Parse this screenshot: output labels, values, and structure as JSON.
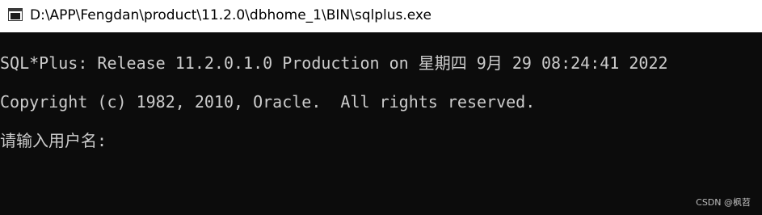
{
  "window": {
    "title": "D:\\APP\\Fengdan\\product\\11.2.0\\dbhome_1\\BIN\\sqlplus.exe",
    "icon": "console-window-icon"
  },
  "console": {
    "lines": [
      "SQL*Plus: Release 11.2.0.1.0 Production on 星期四 9月 29 08:24:41 2022",
      "Copyright (c) 1982, 2010, Oracle.  All rights reserved.",
      "请输入用户名:"
    ]
  },
  "watermark": "CSDN @枫苕",
  "colors": {
    "titlebar_bg": "#ffffff",
    "console_bg": "#0c0c0c",
    "console_text": "#cccccc"
  }
}
